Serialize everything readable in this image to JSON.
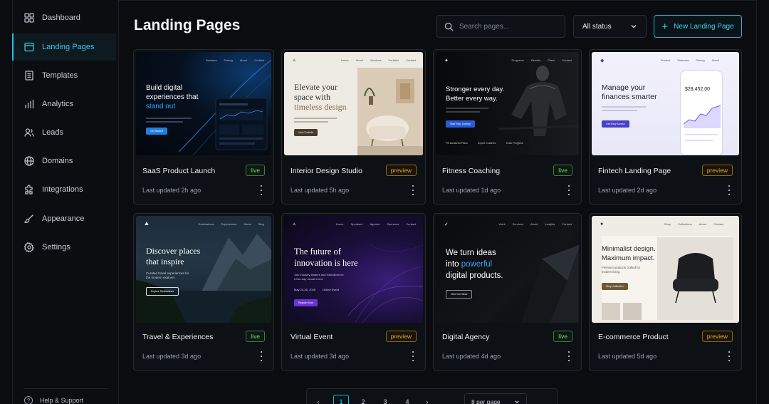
{
  "sidebar": {
    "items": [
      {
        "label": "Dashboard",
        "icon": "grid-icon"
      },
      {
        "label": "Landing Pages",
        "icon": "browser-icon",
        "active": true
      },
      {
        "label": "Templates",
        "icon": "document-icon"
      },
      {
        "label": "Analytics",
        "icon": "bar-chart-icon"
      },
      {
        "label": "Leads",
        "icon": "users-icon"
      },
      {
        "label": "Domains",
        "icon": "globe-icon"
      },
      {
        "label": "Integrations",
        "icon": "puzzle-icon"
      },
      {
        "label": "Appearance",
        "icon": "brush-icon"
      },
      {
        "label": "Settings",
        "icon": "gear-icon"
      }
    ],
    "help_label": "Help & Support"
  },
  "header": {
    "title": "Landing Pages",
    "search_placeholder": "Search pages...",
    "status_filter": "All status",
    "new_button": "New Landing Page"
  },
  "colors": {
    "accent": "#1fc2e4",
    "live": "#7fcf86",
    "preview": "#e0aa3a"
  },
  "cards": [
    {
      "title": "SaaS Product Launch",
      "status": "live",
      "updated": "Last updated 2h ago",
      "thumb": {
        "nav": [
          "Features",
          "Pricing",
          "About",
          "Contact"
        ],
        "headline1": "Build digital",
        "headline2": "experiences that",
        "headline3": "stand out",
        "cta": "Get Started"
      }
    },
    {
      "title": "Interior Design Studio",
      "status": "preview",
      "updated": "Last updated 5h ago",
      "thumb": {
        "nav": [
          "Home",
          "About",
          "Services",
          "Portfolio",
          "Contact"
        ],
        "headline1": "Elevate your",
        "headline2": "space with",
        "headline3": "timeless design",
        "cta": "View Portfolio"
      }
    },
    {
      "title": "Fitness Coaching",
      "status": "live",
      "updated": "Last updated 1d ago",
      "thumb": {
        "nav": [
          "Programs",
          "Results",
          "Plans",
          "Contact"
        ],
        "headline1": "Stronger every day.",
        "headline2": "Better every way.",
        "cta": "Start Your Journey",
        "features": [
          "Personalized Plans",
          "Expert Coaches",
          "Track Progress"
        ]
      }
    },
    {
      "title": "Fintech Landing Page",
      "status": "preview",
      "updated": "Last updated 2d ago",
      "thumb": {
        "nav": [
          "Product",
          "Features",
          "Pricing",
          "About"
        ],
        "headline1": "Manage your",
        "headline2": "finances smarter",
        "cta": "Get Early Access",
        "amount": "$28,452.00"
      }
    },
    {
      "title": "Travel & Experiences",
      "status": "live",
      "updated": "Last updated 3d ago",
      "thumb": {
        "nav": [
          "Destinations",
          "Experiences",
          "About",
          "Blog"
        ],
        "headline1": "Discover places",
        "headline2": "that inspire",
        "sub": "Curated travel experiences for the modern explorer.",
        "cta": "Explore Destinations"
      }
    },
    {
      "title": "Virtual Event",
      "status": "preview",
      "updated": "Last updated 3d ago",
      "thumb": {
        "nav": [
          "Home",
          "Speakers",
          "Agenda",
          "Sponsors",
          "Contact"
        ],
        "headline1": "The future of",
        "headline2": "innovation is here",
        "sub": "Join industry leaders and innovators for a two-day virtual event.",
        "date": "May 24-25, 2025",
        "mode": "Online Event",
        "cta": "Register Now"
      }
    },
    {
      "title": "Digital Agency",
      "status": "live",
      "updated": "Last updated 4d ago",
      "thumb": {
        "nav": [
          "Work",
          "Services",
          "About",
          "Insights",
          "Contact"
        ],
        "headline1": "We turn ideas",
        "headline2a": "into ",
        "headline2b": "powerful",
        "headline3": "digital products.",
        "cta": "View Our Work"
      }
    },
    {
      "title": "E-commerce Product",
      "status": "preview",
      "updated": "Last updated 5d ago",
      "thumb": {
        "nav": [
          "Shop",
          "Collections",
          "About",
          "Contact"
        ],
        "headline1": "Minimalist design.",
        "headline2": "Maximum impact.",
        "sub": "Premium products crafted for modern living.",
        "cta": "Shop Collection"
      }
    }
  ],
  "pagination": {
    "pages": [
      "1",
      "2",
      "3",
      "4"
    ],
    "current": "1",
    "prev": "‹",
    "next": "›",
    "per_page": "8 per page"
  }
}
